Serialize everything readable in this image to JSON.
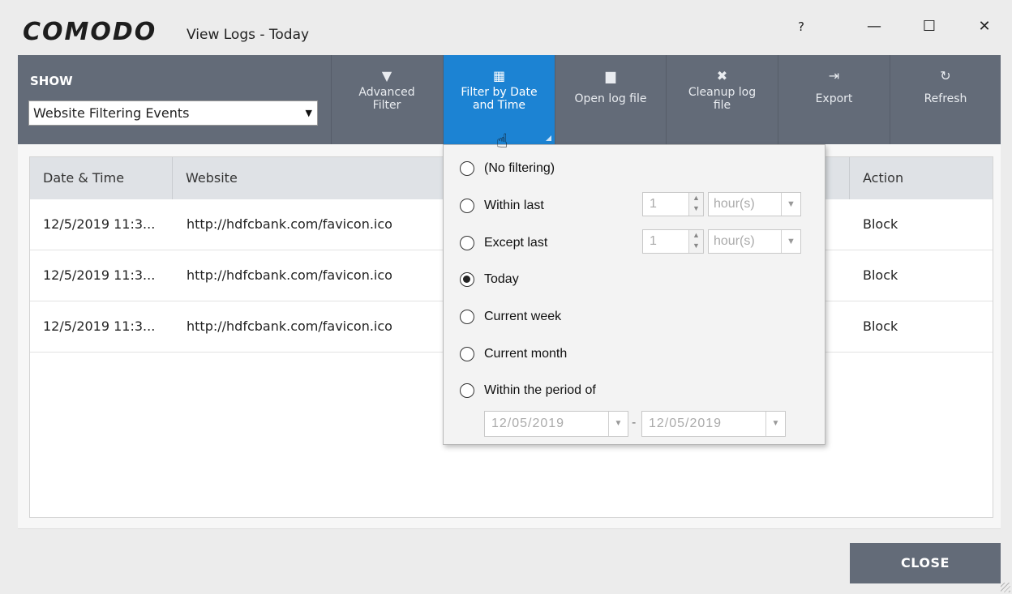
{
  "window": {
    "logo": "COMODO",
    "title": "View Logs - Today",
    "help": "?",
    "minimize": "—",
    "maximize": "☐",
    "close": "✕"
  },
  "toolbar": {
    "show_label": "SHOW",
    "show_value": "Website Filtering Events",
    "buttons": [
      {
        "icon": "funnel-icon",
        "glyph": "▼",
        "line1": "Advanced",
        "line2": "Filter"
      },
      {
        "icon": "calendar-icon",
        "glyph": "▦",
        "line1": "Filter by Date",
        "line2": "and Time"
      },
      {
        "icon": "folder-icon",
        "glyph": "▆",
        "line1": "Open log file",
        "line2": ""
      },
      {
        "icon": "x-icon",
        "glyph": "✖",
        "line1": "Cleanup log",
        "line2": "file"
      },
      {
        "icon": "export-icon",
        "glyph": "⇥",
        "line1": "Export",
        "line2": ""
      },
      {
        "icon": "refresh-icon",
        "glyph": "↻",
        "line1": "Refresh",
        "line2": ""
      }
    ]
  },
  "table": {
    "columns": [
      "Date & Time",
      "Website",
      "Action"
    ],
    "rows": [
      {
        "date": "12/5/2019 11:3...",
        "website": "http://hdfcbank.com/favicon.ico",
        "action": "Block"
      },
      {
        "date": "12/5/2019 11:3...",
        "website": "http://hdfcbank.com/favicon.ico",
        "action": "Block"
      },
      {
        "date": "12/5/2019 11:3...",
        "website": "http://hdfcbank.com/favicon.ico",
        "action": "Block"
      }
    ]
  },
  "filter_popup": {
    "options": [
      "(No filtering)",
      "Within last",
      "Except last",
      "Today",
      "Current week",
      "Current month",
      "Within the period of"
    ],
    "selected": "Today",
    "within_last_value": "1",
    "within_last_unit": "hour(s)",
    "except_last_value": "1",
    "except_last_unit": "hour(s)",
    "period_from": "12/05/2019",
    "period_to": "12/05/2019",
    "dash": "-"
  },
  "footer": {
    "close_label": "CLOSE"
  },
  "colors": {
    "toolbar_bg": "#636b78",
    "active_button": "#1c83d3"
  }
}
